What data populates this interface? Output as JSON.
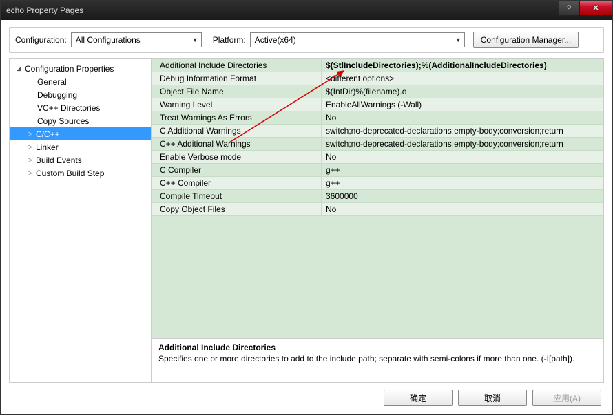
{
  "window": {
    "title": "echo Property Pages"
  },
  "titlebar_buttons": {
    "help": "?",
    "close": "✕"
  },
  "top": {
    "config_label": "Configuration:",
    "config_value": "All Configurations",
    "platform_label": "Platform:",
    "platform_value": "Active(x64)",
    "manager_btn": "Configuration Manager..."
  },
  "tree": {
    "root": "Configuration Properties",
    "items": [
      {
        "label": "General",
        "arrow": ""
      },
      {
        "label": "Debugging",
        "arrow": ""
      },
      {
        "label": "VC++ Directories",
        "arrow": ""
      },
      {
        "label": "Copy Sources",
        "arrow": ""
      },
      {
        "label": "C/C++",
        "arrow": "▷",
        "selected": true
      },
      {
        "label": "Linker",
        "arrow": "▷"
      },
      {
        "label": "Build Events",
        "arrow": "▷"
      },
      {
        "label": "Custom Build Step",
        "arrow": "▷"
      }
    ]
  },
  "props": [
    {
      "name": "Additional Include Directories",
      "value": "$(StlIncludeDirectories);%(AdditionalIncludeDirectories)",
      "selected": true
    },
    {
      "name": "Debug Information Format",
      "value": "<different options>"
    },
    {
      "name": "Object File Name",
      "value": "$(IntDir)%(filename).o"
    },
    {
      "name": "Warning Level",
      "value": "EnableAllWarnings (-Wall)"
    },
    {
      "name": "Treat Warnings As Errors",
      "value": "No"
    },
    {
      "name": "C Additional Warnings",
      "value": "switch;no-deprecated-declarations;empty-body;conversion;return"
    },
    {
      "name": "C++ Additional Warnings",
      "value": "switch;no-deprecated-declarations;empty-body;conversion;return"
    },
    {
      "name": "Enable Verbose mode",
      "value": "No"
    },
    {
      "name": "C Compiler",
      "value": "g++"
    },
    {
      "name": "C++ Compiler",
      "value": "g++"
    },
    {
      "name": "Compile Timeout",
      "value": "3600000"
    },
    {
      "name": "Copy Object Files",
      "value": "No"
    }
  ],
  "desc": {
    "title": "Additional Include Directories",
    "body": "Specifies one or more directories to add to the include path; separate with semi-colons if more than one. (-I[path])."
  },
  "buttons": {
    "ok": "确定",
    "cancel": "取消",
    "apply": "应用(A)"
  }
}
